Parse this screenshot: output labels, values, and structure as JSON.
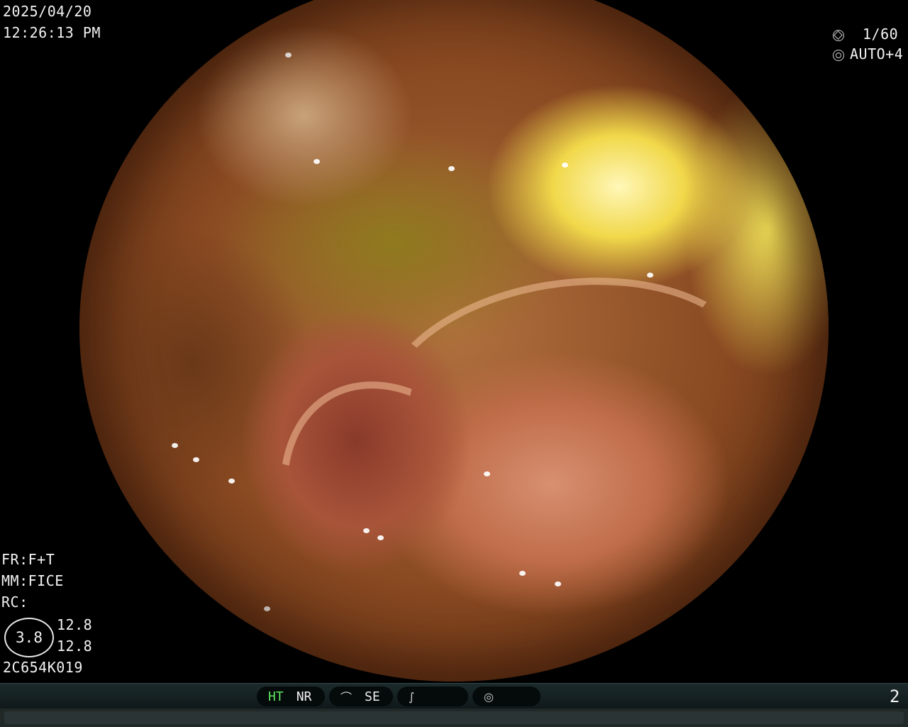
{
  "datetime": {
    "date": "2025/04/20",
    "time": "12:26:13  PM"
  },
  "exposure": {
    "shutter": "1/60",
    "iris": "AUTO+4",
    "shutter_icon": "shutter-icon",
    "iris_icon": "iris-icon"
  },
  "settings": {
    "fr": "FR:F+T",
    "mm": "MM:FICE",
    "rc": "RC:"
  },
  "zoom_badge": {
    "value": "3.8",
    "line1": "12.8",
    "line2": "12.8"
  },
  "scope_id": "2C654K019",
  "status_bar": {
    "ht": "HT",
    "nr": "NR",
    "se": "SE",
    "image_count": "2",
    "colors": {
      "ht": "#5ee65e",
      "bar": "#1c2a2c"
    }
  }
}
